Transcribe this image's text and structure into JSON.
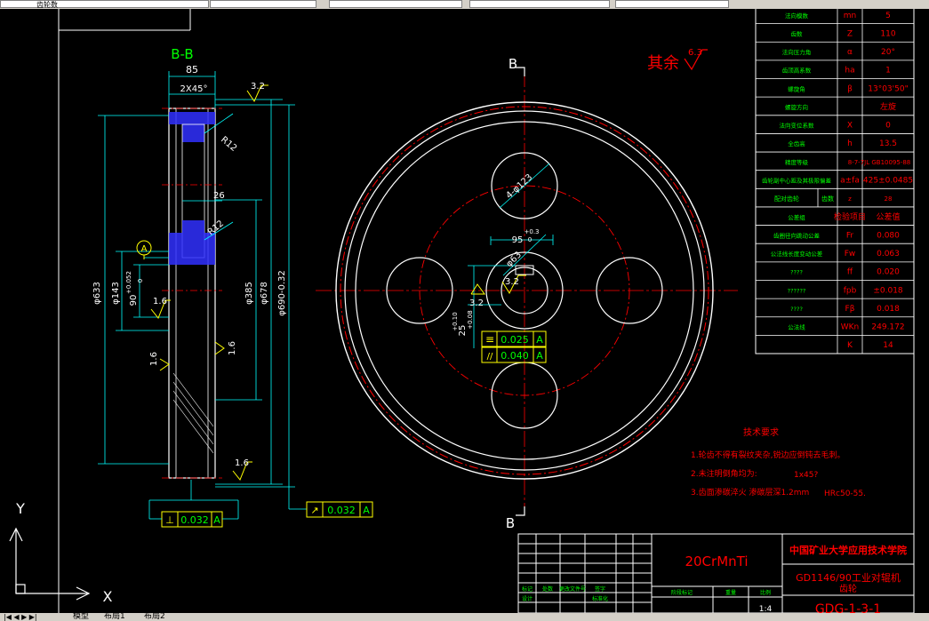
{
  "toolbar": {
    "layer_name": "齿轮数",
    "field2": "",
    "field3": "",
    "field4": ""
  },
  "layout_tabs": [
    "模型",
    "布局1",
    "布局2"
  ],
  "section": {
    "title": "B-B",
    "dim_width": "85",
    "dim_chamfer": "2X45°",
    "dim_r12_top": "R12",
    "dim_26": "26",
    "dim_r12_bottom": "R12",
    "dim_633": "φ633",
    "dim_143": "φ143",
    "dim_90": "90",
    "dim_90_tol": "+0.052",
    "dim_90_tol2": "0",
    "dim_385": "φ385",
    "dim_678": "φ678",
    "dim_690": "φ690-0.32",
    "datum": "A",
    "rough_top": "3.2",
    "rough_16a": "1.6",
    "rough_16b": "1.6",
    "rough_16c": "1.6",
    "rough_16d": "1.6",
    "tol_perp_symbol": "⊥",
    "tol_perp_value": "0.032",
    "tol_perp_datum": "A",
    "tol_runout_symbol": "↗",
    "tol_runout_value": "0.032",
    "tol_runout_datum": "A"
  },
  "front": {
    "label_b_top": "B",
    "label_b_bottom": "B",
    "other_rough": "其余",
    "other_rough_value": "6.3",
    "dim_holes": "4-φ123",
    "dim_keyway": "95",
    "dim_keyway_tol_up": "+0.3",
    "dim_keyway_tol_dn": "0",
    "dim_bore": "φ63",
    "dim_25": "25",
    "dim_25_tol_up": "+0.10",
    "dim_25_tol_dn": "+0.08",
    "rough_32a": "3.2",
    "rough_32b": "3.2",
    "tol_sym_symbol": "≡",
    "tol_sym_value": "0.025",
    "tol_sym_datum": "A",
    "tol_par_symbol": "//",
    "tol_par_value": "0.040",
    "tol_par_datum": "A"
  },
  "params_table": [
    [
      "法向模数",
      "mn",
      "5"
    ],
    [
      "齿数",
      "Z",
      "110"
    ],
    [
      "法向压力角",
      "α",
      "20°"
    ],
    [
      "齿顶高系数",
      "ha",
      "1"
    ],
    [
      "螺旋角",
      "β",
      "13°03'50\""
    ],
    [
      "螺旋方向",
      "",
      "左旋"
    ],
    [
      "法向变位系数",
      "X",
      "0"
    ],
    [
      "全齿高",
      "h",
      "13.5"
    ],
    [
      "精度等级",
      "",
      "8-7-7JL GB10095-88"
    ],
    [
      "齿轮副中心距及其极限偏差",
      "a±fa",
      "425±0.0485"
    ],
    [
      "配对齿轮",
      "齿数",
      "z",
      "28"
    ],
    [
      "公差组",
      "检验项目",
      "公差值"
    ],
    [
      "齿圈径向跳动公差",
      "Fr",
      "0.080"
    ],
    [
      "公法线长度变动公差",
      "Fw",
      "0.063"
    ],
    [
      "????",
      "ff",
      "0.020"
    ],
    [
      "??????",
      "fpb",
      "±0.018"
    ],
    [
      "????",
      "Fβ",
      "0.018"
    ],
    [
      "公法线",
      "WKn",
      "249.172"
    ],
    [
      "",
      "K",
      "14"
    ]
  ],
  "tech_req": {
    "title": "技术要求",
    "item1": "1.轮齿不得有裂纹夹杂,锐边应倒钝去毛刺。",
    "item2": "2.未注明倒角均为:",
    "item2_val": "1x45?",
    "item3": "3.齿面渗碳淬火 渗碳层深1.2mm",
    "item3_val": "HRc50-55."
  },
  "title_block": {
    "material": "20CrMnTi",
    "school": "中国矿业大学应用技术学院",
    "project": "GD1146/90工业对辊机",
    "part": "齿轮",
    "drawing_no": "GDG-1-3-1",
    "h_biaoji": "标记",
    "h_chushu": "处数",
    "h_gengai": "更改文件号",
    "h_qianzi": "签字",
    "h_sheji": "设计",
    "h_biaozhunhua": "标准化",
    "h_jieduan": "阶段标记",
    "h_zhongliang": "重量",
    "h_bili": "比例",
    "scale": "1:4"
  },
  "ucs": {
    "x": "X",
    "y": "Y"
  },
  "colors": {
    "white": "#ffffff",
    "red": "#ff0000",
    "green": "#00ff00",
    "cyan": "#00ffff",
    "yellow": "#ffff00",
    "blue": "#3030ff"
  }
}
